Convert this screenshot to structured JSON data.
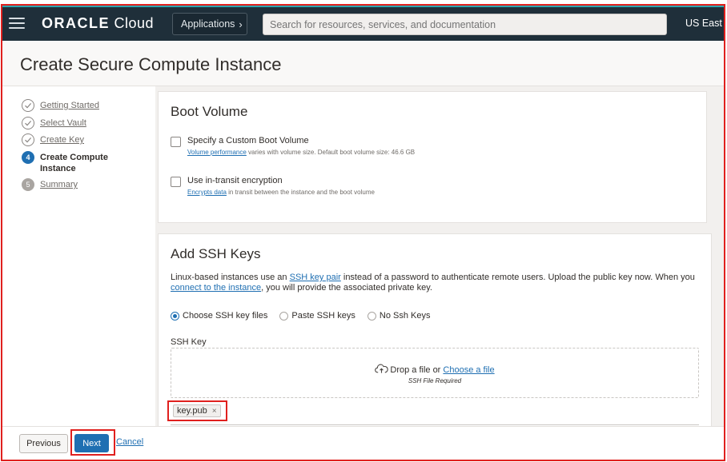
{
  "header": {
    "brand": "ORACLE",
    "product": "Cloud",
    "applications_label": "Applications",
    "search_placeholder": "Search for resources, services, and documentation",
    "region": "US East"
  },
  "page": {
    "title": "Create Secure Compute Instance"
  },
  "steps": [
    {
      "number": "1",
      "label": "Getting Started",
      "state": "done"
    },
    {
      "number": "2",
      "label": "Select Vault",
      "state": "done"
    },
    {
      "number": "3",
      "label": "Create Key",
      "state": "done"
    },
    {
      "number": "4",
      "label": "Create Compute Instance",
      "state": "current"
    },
    {
      "number": "5",
      "label": "Summary",
      "state": "todo"
    }
  ],
  "boot_volume": {
    "heading": "Boot Volume",
    "custom": {
      "label": "Specify a Custom Boot Volume",
      "help_link": "Volume performance",
      "help_text": " varies with volume size. Default boot volume size: 46.6 GB"
    },
    "encryption": {
      "label": "Use in-transit encryption",
      "help_link": "Encrypts data",
      "help_text": " in transit between the instance and the boot volume"
    }
  },
  "ssh": {
    "heading": "Add SSH Keys",
    "desc_1": "Linux-based instances use an ",
    "desc_link_1": "SSH key pair",
    "desc_2": " instead of a password to authenticate remote users. Upload the public key now. When you ",
    "desc_link_2": "connect to the instance",
    "desc_3": ", you will provide the associated private key.",
    "options": [
      {
        "label": "Choose SSH key files",
        "selected": true
      },
      {
        "label": "Paste SSH keys",
        "selected": false
      },
      {
        "label": "No Ssh Keys",
        "selected": false
      }
    ],
    "field_label": "SSH Key",
    "drop_text": "Drop a file or ",
    "drop_link": "Choose a file",
    "drop_sub": "SSH File Required",
    "file_name": "key.pub",
    "remove_glyph": "×"
  },
  "footer": {
    "previous": "Previous",
    "next": "Next",
    "cancel": "Cancel"
  },
  "colors": {
    "topbar": "#1f2f3a",
    "accent": "#1f6fb2",
    "annotation": "#e0201e"
  },
  "icons": {
    "menu": "hamburger-icon",
    "done_step": "check-circle-icon",
    "upload": "cloud-upload-icon",
    "remove": "close-icon"
  }
}
